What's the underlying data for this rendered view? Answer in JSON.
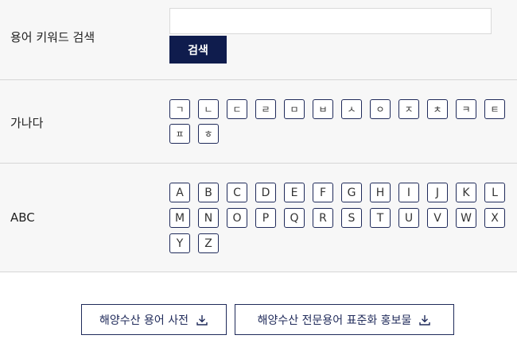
{
  "search": {
    "label": "용어 키워드 검색",
    "input_value": "",
    "button_label": "검색"
  },
  "korean_index": {
    "label": "가나다",
    "keys": [
      "ㄱ",
      "ㄴ",
      "ㄷ",
      "ㄹ",
      "ㅁ",
      "ㅂ",
      "ㅅ",
      "ㅇ",
      "ㅈ",
      "ㅊ",
      "ㅋ",
      "ㅌ",
      "ㅍ",
      "ㅎ"
    ]
  },
  "alpha_index": {
    "label": "ABC",
    "keys": [
      "A",
      "B",
      "C",
      "D",
      "E",
      "F",
      "G",
      "H",
      "I",
      "J",
      "K",
      "L",
      "M",
      "N",
      "O",
      "P",
      "Q",
      "R",
      "S",
      "T",
      "U",
      "V",
      "W",
      "X",
      "Y",
      "Z"
    ]
  },
  "downloads": [
    {
      "label": "해양수산 용어 사전",
      "icon": "download-icon"
    },
    {
      "label": "해양수산 전문용어 표준화 홍보물",
      "icon": "download-icon"
    }
  ],
  "colors": {
    "accent": "#0f1c4d",
    "border": "#1f2a5a",
    "panel_bg": "#f7f7f7"
  }
}
